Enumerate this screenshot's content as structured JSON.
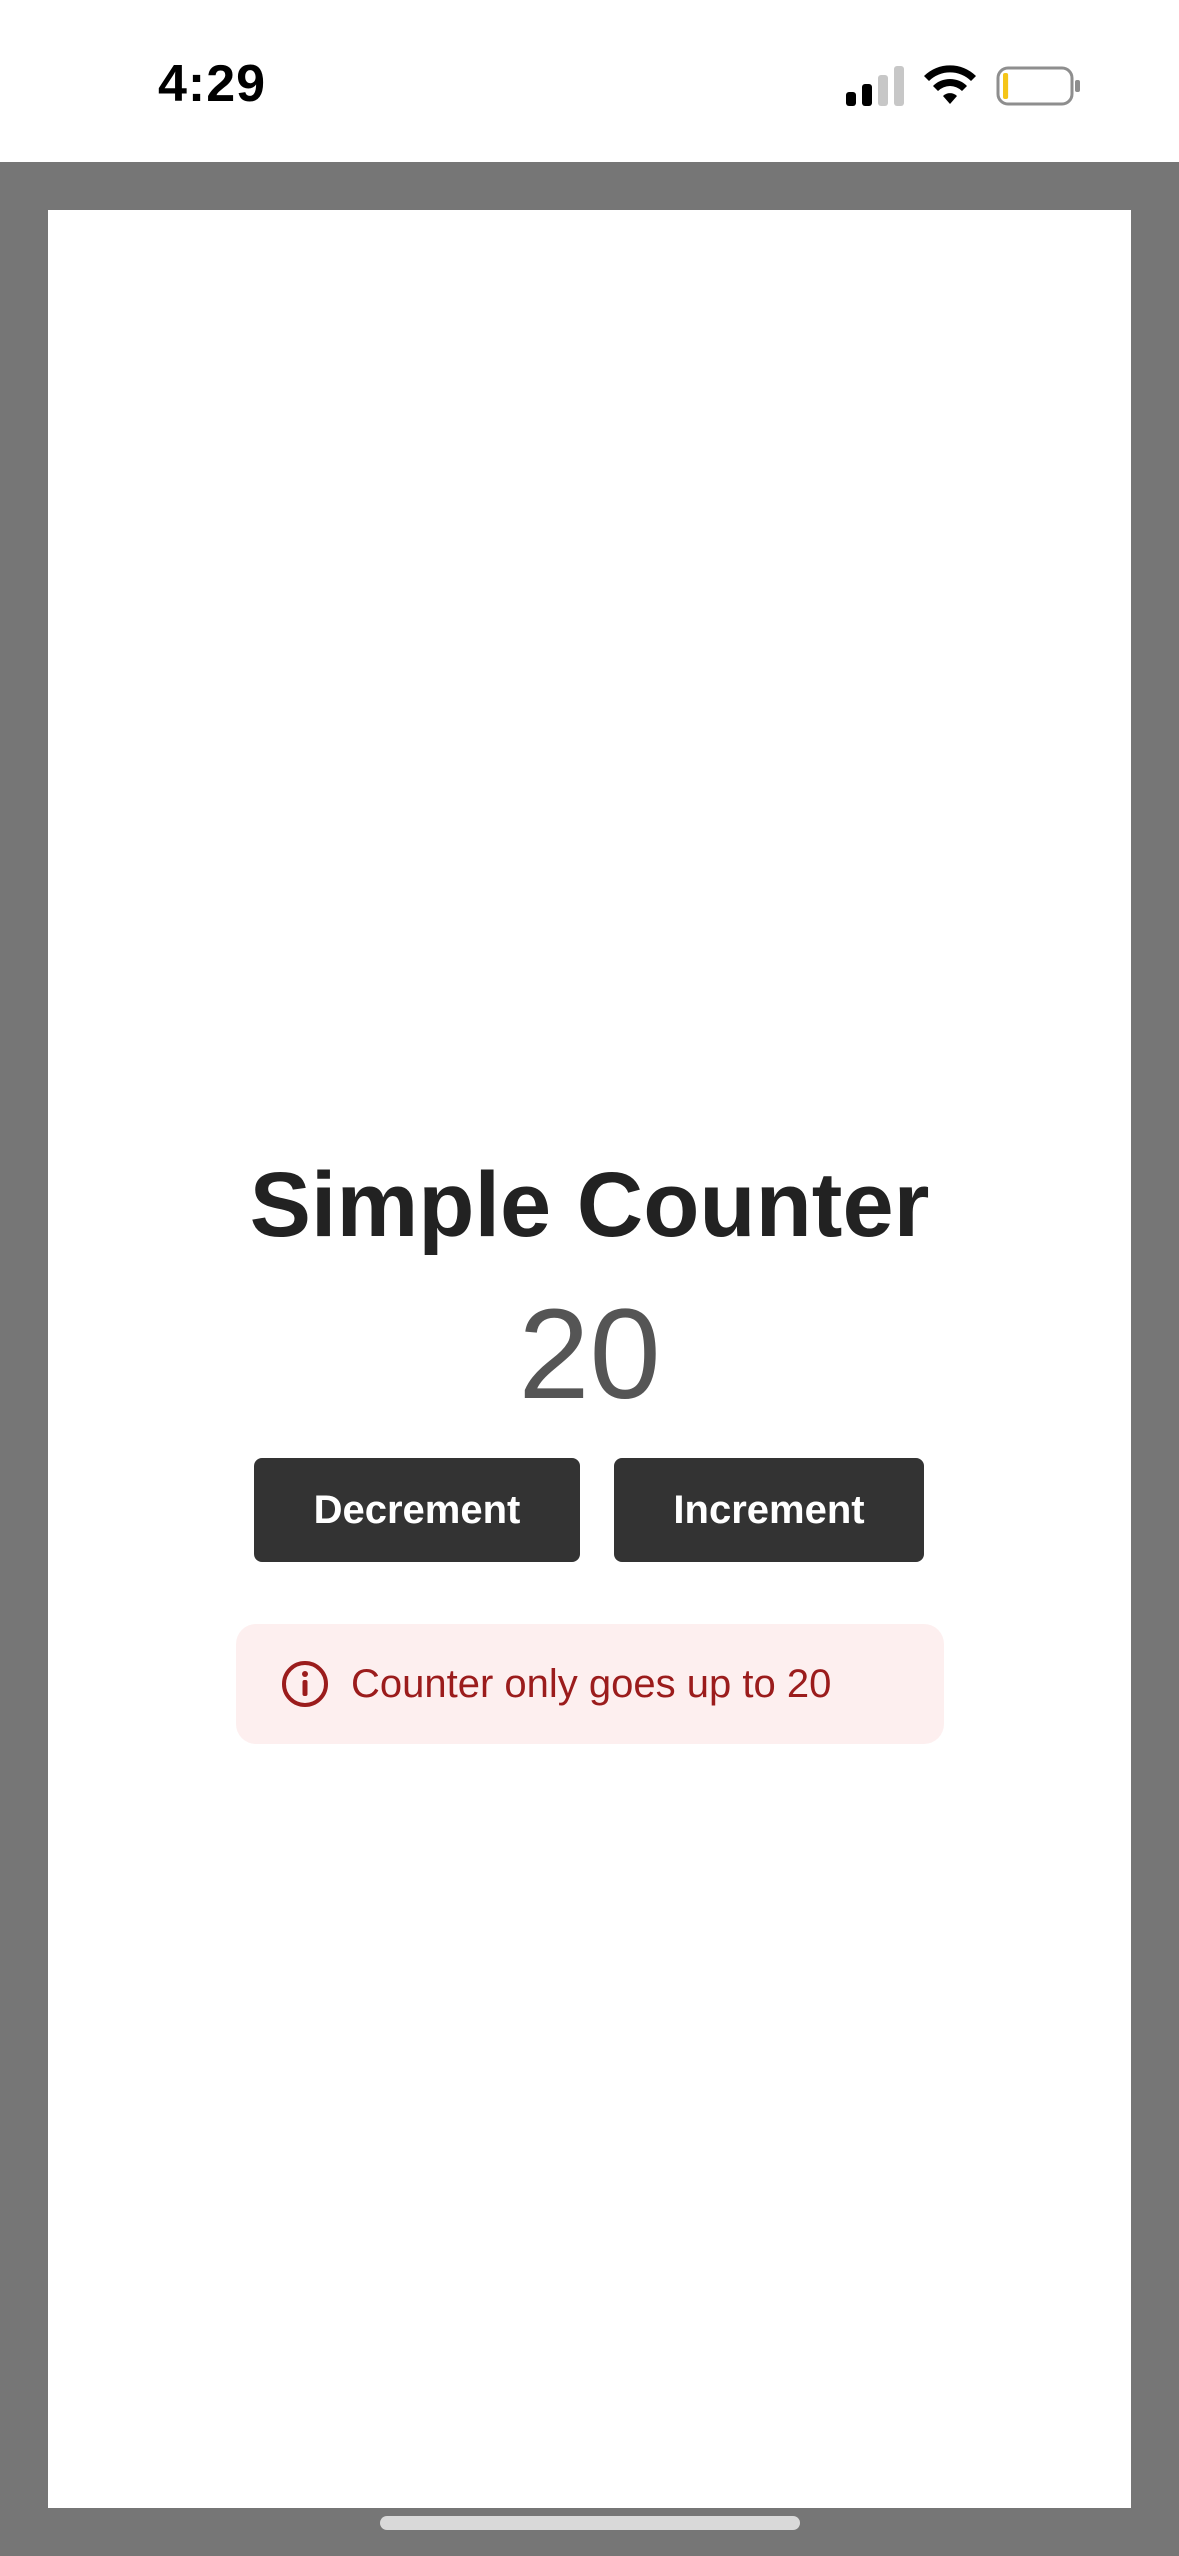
{
  "status_bar": {
    "time": "4:29",
    "signal_icon": "cellular-signal-icon",
    "wifi_icon": "wifi-icon",
    "battery_icon": "battery-icon",
    "battery_level": 0.08,
    "battery_color": "#f5c518"
  },
  "app": {
    "title": "Simple Counter",
    "count": "20",
    "decrement_label": "Decrement",
    "increment_label": "Increment",
    "alert": {
      "icon": "info-icon",
      "message": "Counter only goes up to 20",
      "text_color": "#9b1c1c",
      "background_color": "#fdefef"
    },
    "button_color": "#333333"
  }
}
